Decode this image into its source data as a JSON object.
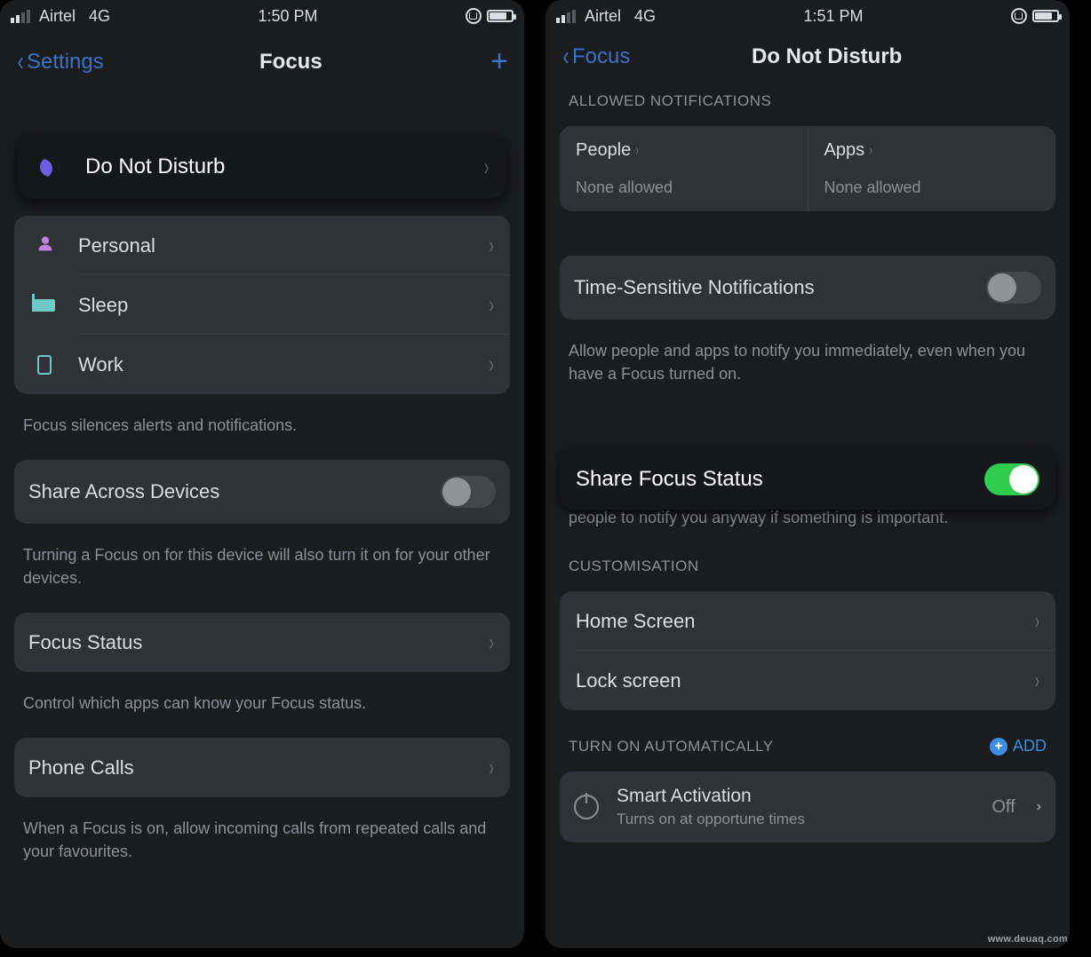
{
  "left": {
    "status": {
      "carrier": "Airtel",
      "network": "4G",
      "time": "1:50 PM"
    },
    "nav": {
      "back": "Settings",
      "title": "Focus"
    },
    "focus_items": [
      {
        "label": "Do Not Disturb",
        "icon": "moon-icon"
      },
      {
        "label": "Personal",
        "icon": "person-icon"
      },
      {
        "label": "Sleep",
        "icon": "bed-icon"
      },
      {
        "label": "Work",
        "icon": "badge-icon"
      }
    ],
    "focus_caption": "Focus silences alerts and notifications.",
    "share_devices": {
      "label": "Share Across Devices",
      "caption": "Turning a Focus on for this device will also turn it on for your other devices.",
      "on": false
    },
    "focus_status": {
      "label": "Focus Status",
      "caption": "Control which apps can know your Focus status."
    },
    "phone_calls": {
      "label": "Phone Calls",
      "caption": "When a Focus is on, allow incoming calls from repeated calls and your favourites."
    }
  },
  "right": {
    "status": {
      "carrier": "Airtel",
      "network": "4G",
      "time": "1:51 PM"
    },
    "nav": {
      "back": "Focus",
      "title": "Do Not Disturb"
    },
    "allowed_header": "ALLOWED NOTIFICATIONS",
    "allowed": {
      "people": {
        "label": "People",
        "value": "None allowed"
      },
      "apps": {
        "label": "Apps",
        "value": "None allowed"
      }
    },
    "time_sensitive": {
      "label": "Time-Sensitive Notifications",
      "caption": "Allow people and apps to notify you immediately, even when you have a Focus turned on.",
      "on": false
    },
    "share_focus": {
      "label": "Share Focus Status",
      "caption": "When this is on, tell apps you have notifications silenced and allow people to notify you anyway if something is important.",
      "on": true
    },
    "customisation_header": "CUSTOMISATION",
    "home_screen": "Home Screen",
    "lock_screen": "Lock screen",
    "auto_header": "TURN ON AUTOMATICALLY",
    "add_label": "ADD",
    "smart": {
      "title": "Smart Activation",
      "subtitle": "Turns on at opportune times",
      "value": "Off"
    }
  },
  "watermark": "www.deuaq.com"
}
